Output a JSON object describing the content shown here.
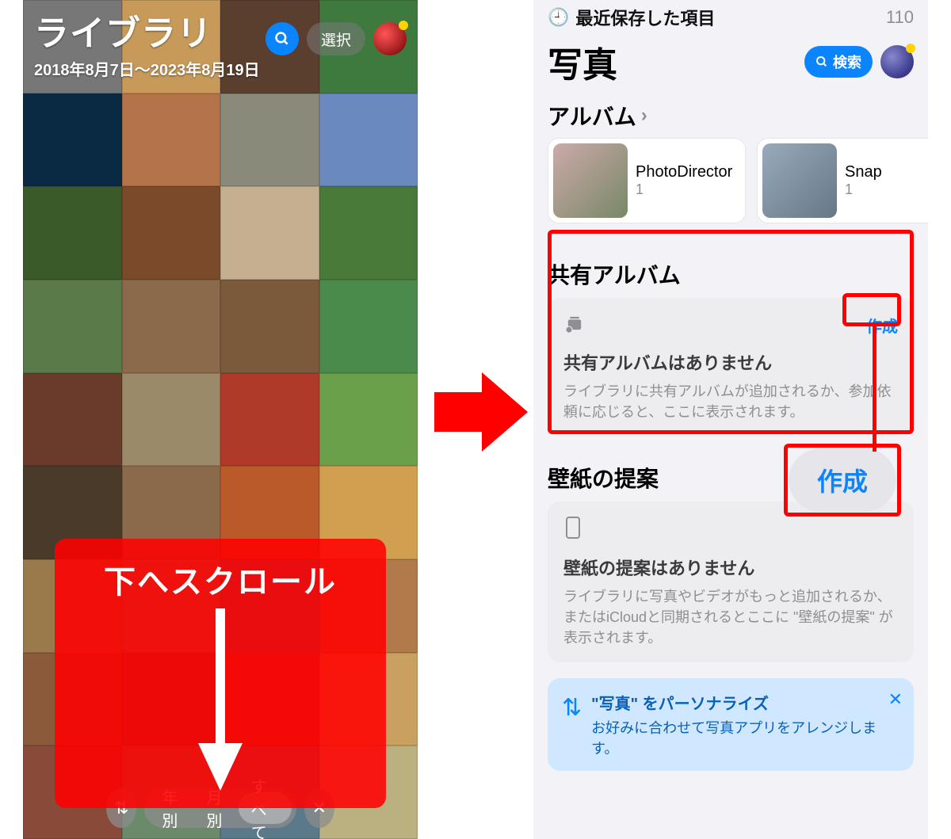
{
  "left": {
    "title": "ライブラリ",
    "dateRange": "2018年8月7日〜2023年8月19日",
    "selectLabel": "選択",
    "segments": {
      "year": "年別",
      "month": "月別",
      "all": "すべて"
    },
    "sortIcon": "⇅",
    "closeIcon": "✕",
    "overlayText": "下へスクロール"
  },
  "right": {
    "recentLabel": "最近保存した項目",
    "recentCount": "110",
    "title": "写真",
    "searchLabel": "検索",
    "albumsHeader": "アルバム",
    "albums": [
      {
        "name": "PhotoDirector",
        "count": "1"
      },
      {
        "name": "Snap",
        "count": "1"
      }
    ],
    "shared": {
      "header": "共有アルバム",
      "createLabel": "作成",
      "emptyTitle": "共有アルバムはありません",
      "emptyBody": "ライブラリに共有アルバムが追加されるか、参加依頼に応じると、ここに表示されます。"
    },
    "wallpaper": {
      "header": "壁紙の提案",
      "emptyTitle": "壁紙の提案はありません",
      "emptyBody": "ライブラリに写真やビデオがもっと追加されるか、またはiCloudと同期されるとここに \"壁紙の提案\" が表示されます。"
    },
    "banner": {
      "title": "\"写真\" をパーソナライズ",
      "body": "お好みに合わせて写真アプリをアレンジします。"
    },
    "createBigLabel": "作成"
  },
  "gridColors": [
    "#777",
    "#c79a5a",
    "#5a3e2e",
    "#3e7a3e",
    "#0a2a44",
    "#b5734a",
    "#8a8a7a",
    "#6a8abf",
    "#3a5a2a",
    "#7a4a2a",
    "#c4b090",
    "#4a7a3a",
    "#5a7a4a",
    "#8a6a4a",
    "#7a5a3a",
    "#4a8a4a",
    "#6a3a2a",
    "#9a8a6a",
    "#b03a2a",
    "#6aa04a",
    "#4a3a2a",
    "#8a6a4a",
    "#ba5a2a",
    "#d0a050",
    "#9a7a4a",
    "#7a8a6a",
    "#4a6a7a",
    "#b07a4a",
    "#8a5a3a",
    "#6a4a3a",
    "#a04a3a",
    "#caa060",
    "#8a4a3a",
    "#6a8a6a",
    "#5a7a8a",
    "#bab080"
  ]
}
